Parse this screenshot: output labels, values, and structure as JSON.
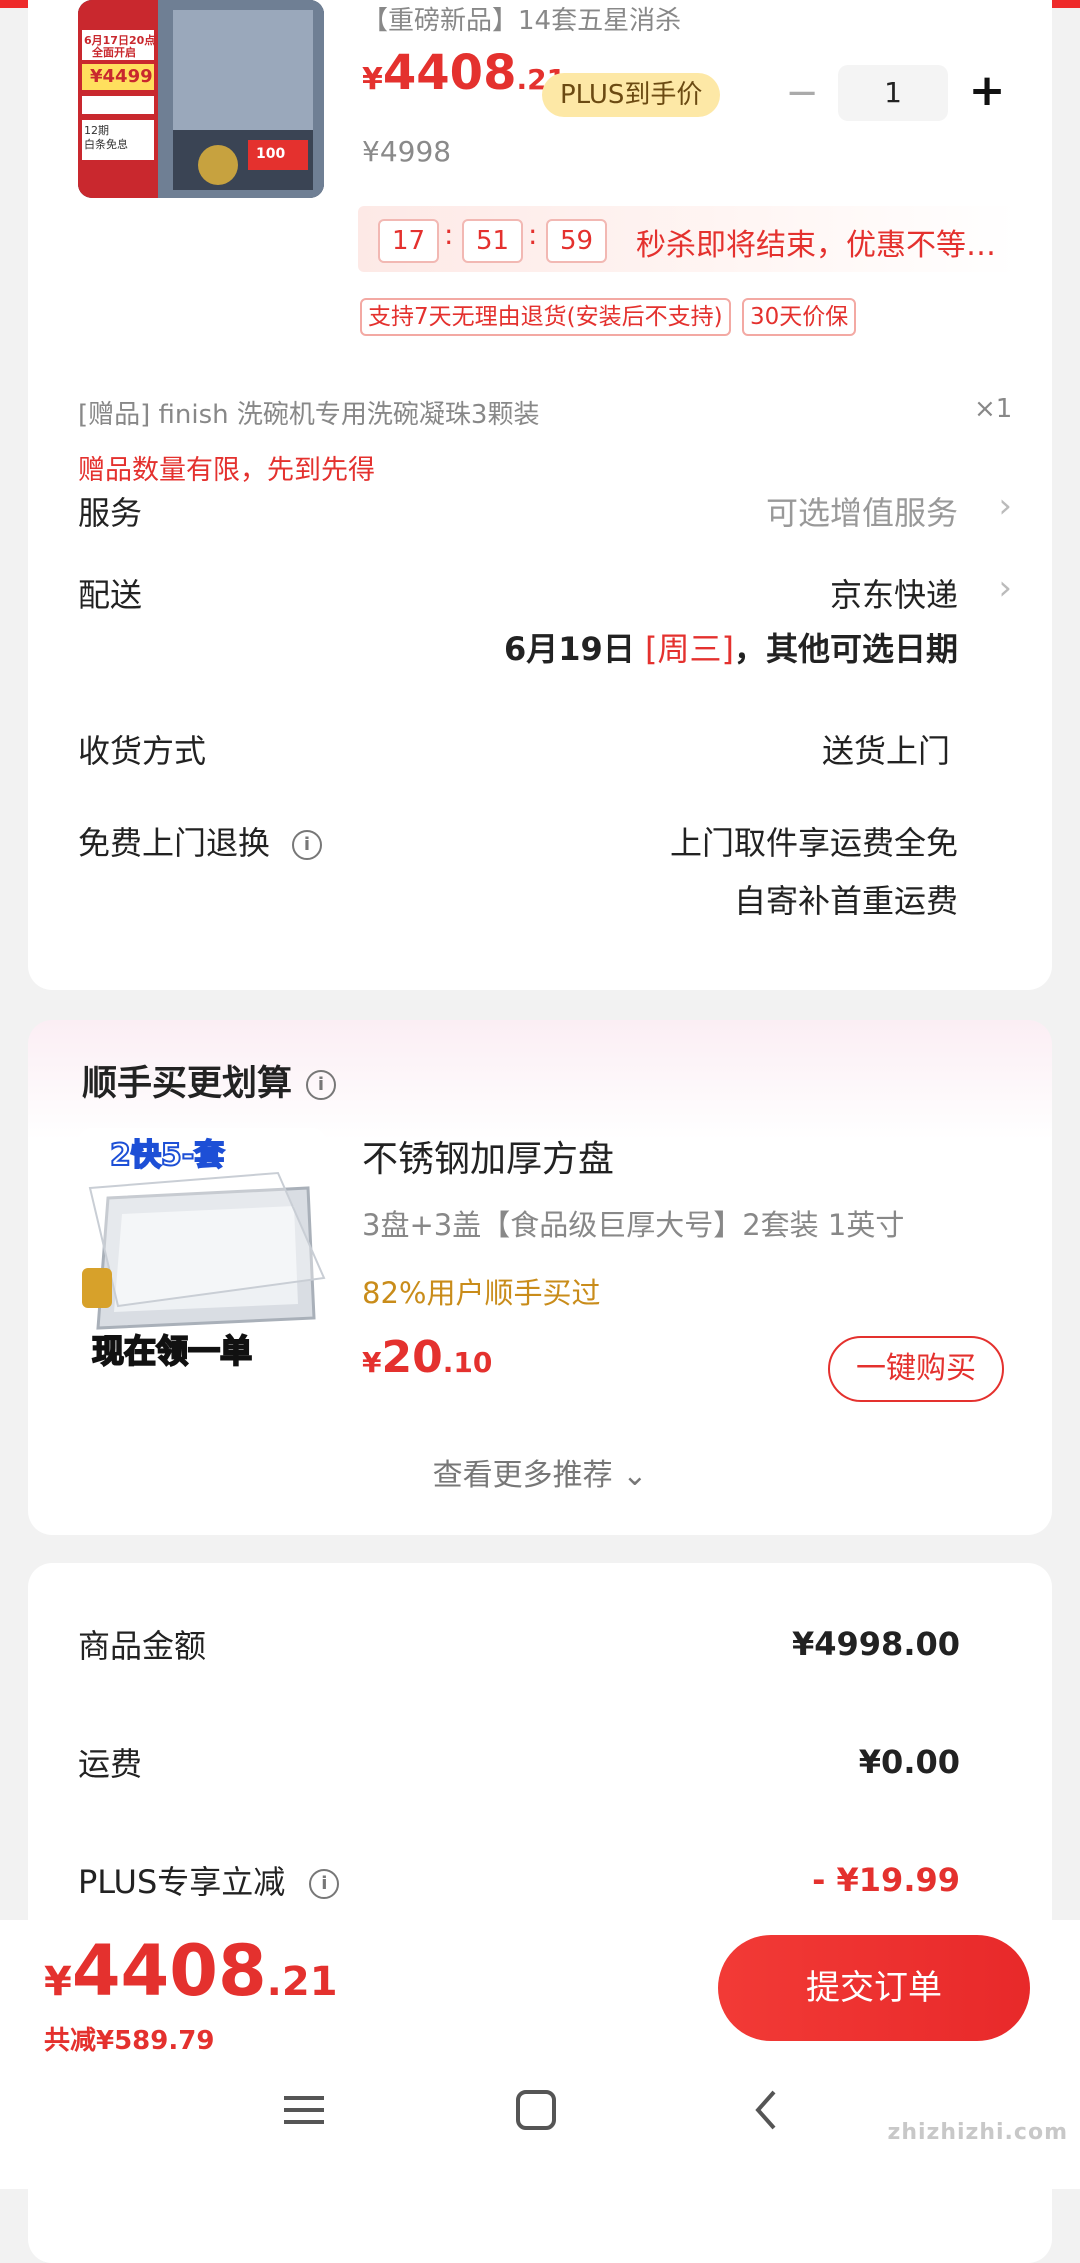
{
  "product": {
    "title": "【重磅新品】14套五星消杀",
    "price_symbol": "¥",
    "price_int": "4408",
    "price_dec": ".21",
    "plus_badge": "PLUS到手价",
    "original_price": "¥4998",
    "quantity": "1",
    "minus_label": "−",
    "plus_label": "+",
    "image_labels": [
      "6月17日20点",
      "全面开启",
      "¥4499",
      "12期",
      "白条免息",
      "100"
    ]
  },
  "flash_sale": {
    "hours": "17",
    "minutes": "51",
    "seconds": "59",
    "colon": ":",
    "text": "秒杀即将结束，优惠不等…"
  },
  "tags": [
    "支持7天无理由退货(安装后不支持)",
    "30天价保"
  ],
  "gift": {
    "text": "[赠品]   finish 洗碗机专用洗碗凝珠3颗装",
    "qty": "×1",
    "note": "赠品数量有限，先到先得"
  },
  "rows": {
    "service_label": "服务",
    "service_value": "可选增值服务",
    "delivery_label": "配送",
    "delivery_value": "京东快递",
    "delivery_date": "6月19日",
    "delivery_weekday": "[周三]",
    "delivery_suffix": "，其他可选日期",
    "receive_label": "收货方式",
    "receive_value": "送货上门",
    "return_label": "免费上门退换",
    "return_value_1": "上门取件享运费全免",
    "return_value_2": "自寄补首重运费",
    "chevron": "›",
    "info_icon": "i"
  },
  "addon": {
    "section_title": "顺手买更划算",
    "image_top_text": "2快5-套",
    "image_bottom_text": "现在领一单",
    "title": "不锈钢加厚方盘",
    "desc": "3盘+3盖【食品级巨厚大号】2套装 1英寸",
    "social": "82%用户顺手买过",
    "price_symbol": "¥",
    "price_int": "20",
    "price_dec": ".10",
    "buy_label": "一键购买",
    "more_label": "查看更多推荐 ⌄"
  },
  "summary": {
    "goods_label": "商品金额",
    "goods_value": "¥4998.00",
    "shipping_label": "运费",
    "shipping_value": "¥0.00",
    "plus_label": "PLUS专享立减",
    "plus_value": "- ¥19.99"
  },
  "bottom": {
    "total_symbol": "¥",
    "total_int": "4408",
    "total_dec": ".21",
    "saved": "共减¥589.79",
    "submit_label": "提交订单"
  },
  "watermark": "zhizhizhi.com",
  "colors": {
    "accent": "#e4312e",
    "plus_badge_bg": "#fde8a6",
    "social_proof": "#c98c1a"
  }
}
